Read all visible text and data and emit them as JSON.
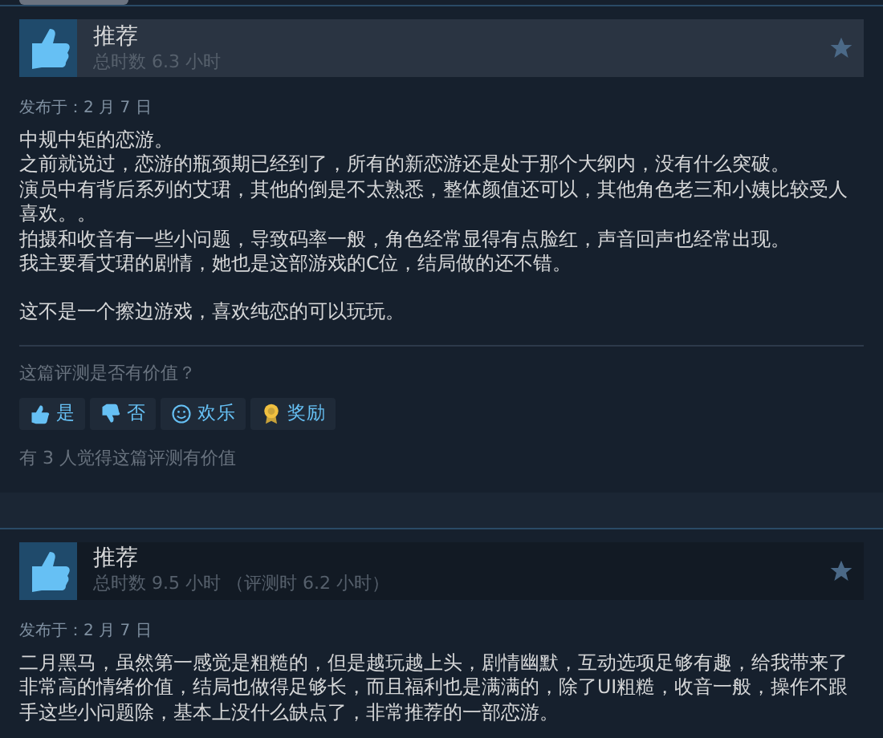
{
  "reviews": [
    {
      "highlighted": true,
      "verdict": "推荐",
      "hours": "总时数 6.3 小时",
      "posted": "发布于：2 月 7 日",
      "paragraphs": [
        [
          "中规中矩的恋游。",
          "之前就说过，恋游的瓶颈期已经到了，所有的新恋游还是处于那个大纲内，没有什么突破。",
          "演员中有背后系列的艾珺，其他的倒是不太熟悉，整体颜值还可以，其他角色老三和小姨比较受人喜欢。。",
          "拍摄和收音有一些小问题，导致码率一般，角色经常显得有点脸红，声音回声也经常出现。",
          "我主要看艾珺的剧情，她也是这部游戏的C位，结局做的还不错。"
        ],
        [
          "这不是一个擦边游戏，喜欢纯恋的可以玩玩。"
        ]
      ],
      "helpful_prompt": "这篇评测是否有价值？",
      "buttons": [
        {
          "kind": "yes",
          "label": "是"
        },
        {
          "kind": "no",
          "label": "否"
        },
        {
          "kind": "funny",
          "label": "欢乐"
        },
        {
          "kind": "award",
          "label": "奖励"
        }
      ],
      "helpful_count": "有 3 人觉得这篇评测有价值"
    },
    {
      "highlighted": false,
      "verdict": "推荐",
      "hours": "总时数 9.5 小时 （评测时 6.2 小时）",
      "posted": "发布于：2 月 7 日",
      "paragraphs": [
        [
          "二月黑马，虽然第一感觉是粗糙的，但是越玩越上头，剧情幽默，互动选项足够有趣，给我带来了非常高的情绪价值，结局也做得足够长，而且福利也是满满的，除了UI粗糙，收音一般，操作不跟手这些小问题除，基本上没什么缺点了，非常推荐的一部恋游。"
        ]
      ]
    }
  ]
}
